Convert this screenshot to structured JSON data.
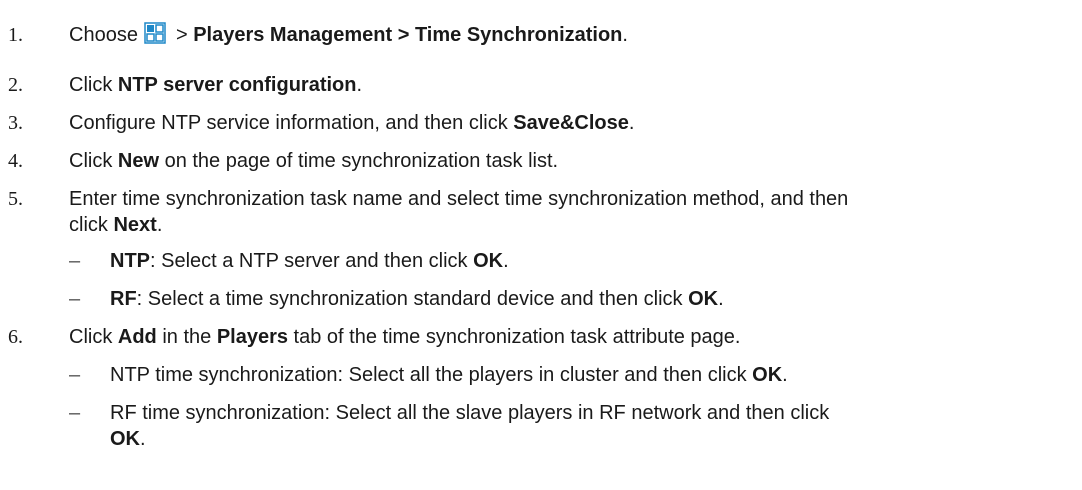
{
  "steps": [
    {
      "num": "1.",
      "choose": "Choose",
      "sep": ">",
      "path": "Players Management > Time Synchronization",
      "end": "."
    },
    {
      "num": "2.",
      "pre": "Click ",
      "bold": "NTP server configuration",
      "post": "."
    },
    {
      "num": "3.",
      "pre": "Configure NTP service information, and then click ",
      "bold": "Save&Close",
      "post": "."
    },
    {
      "num": "4.",
      "pre": "Click ",
      "bold": "New",
      "post": " on the page of time synchronization task list."
    },
    {
      "num": "5.",
      "pre": "Enter time synchronization task name and select time synchronization method, and then click ",
      "bold": "Next",
      "post": "."
    },
    {
      "num": "6.",
      "pre": "Click ",
      "bold": "Add",
      "mid": " in the ",
      "bold2": "Players",
      "post": " tab of the time synchronization task attribute page."
    }
  ],
  "step5_subs": [
    {
      "dash": "–",
      "bold": "NTP",
      "text": ": Select a NTP server and then click ",
      "bold2": "OK",
      "end": "."
    },
    {
      "dash": "–",
      "bold": "RF",
      "text": ": Select a time synchronization standard device and then click ",
      "bold2": "OK",
      "end": "."
    }
  ],
  "step6_subs": [
    {
      "dash": "–",
      "text": "NTP time synchronization: Select all the players in cluster and then click ",
      "bold2": "OK",
      "end": "."
    },
    {
      "dash": "–",
      "text": "RF time synchronization: Select all the slave players in RF network and then click ",
      "bold2": "OK",
      "end": "."
    }
  ],
  "icon": {
    "name": "menu-grid-icon",
    "fill": "#1e88c8",
    "stroke": "#1e88c8"
  }
}
